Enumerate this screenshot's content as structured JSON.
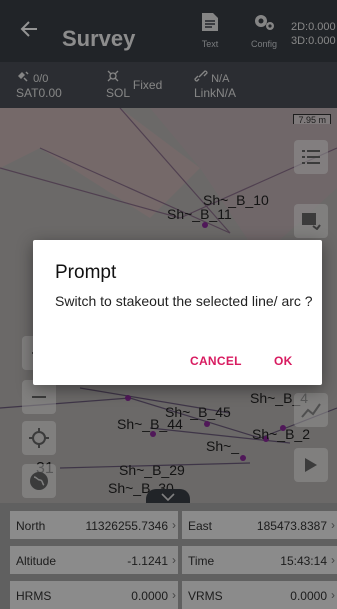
{
  "header": {
    "back_icon": "arrow-left-icon",
    "title": "Survey",
    "text_label": "Text",
    "config_label": "Config",
    "coord_line1": "2D:0.000",
    "coord_line2": "3D:0.000"
  },
  "status": {
    "sat_count": "0/0",
    "sat_label": "SAT",
    "sat_value": "0.00",
    "sol_label": "SOL",
    "sol_value": "Fixed",
    "link_label": "Link",
    "link_value1": "N/A",
    "link_value2": "N/A"
  },
  "map": {
    "scale_label": "7.95 m",
    "labels": [
      "Sh~_B_10",
      "Sh~_B_11",
      "Sh~_B_45",
      "Sh~_B_44",
      "Sh~_B_29",
      "Sh~_B_30",
      "Sh~_B_4",
      "Sh~_B_2",
      "Sh~_",
      "31"
    ]
  },
  "fields": {
    "north_label": "North",
    "north_value": "11326255.7346",
    "east_label": "East",
    "east_value": "185473.8387",
    "altitude_label": "Altitude",
    "altitude_value": "-1.1241",
    "time_label": "Time",
    "time_value": "15:43:14",
    "hrms_label": "HRMS",
    "hrms_value": "0.0000",
    "vrms_label": "VRMS",
    "vrms_value": "0.0000"
  },
  "dialog": {
    "title": "Prompt",
    "message": "Switch to stakeout the selected line/ arc ?",
    "cancel": "CANCEL",
    "ok": "OK"
  },
  "colors": {
    "accent": "#d81b60",
    "header_bg": "#3a3f46",
    "status_bg": "#4a4f56"
  }
}
